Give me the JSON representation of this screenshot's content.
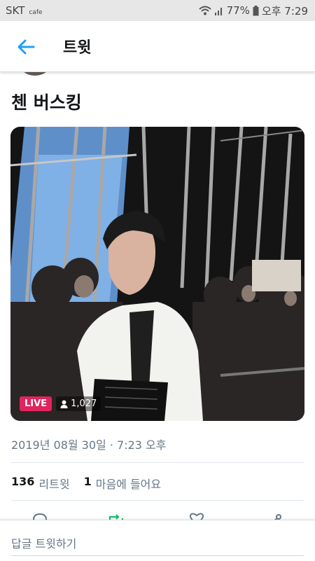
{
  "status_bar": {
    "carrier": "SKT",
    "carrier_sub": "cafe",
    "battery": "77%",
    "time": "오후 7:29"
  },
  "app_bar": {
    "title": "트윗"
  },
  "tweet": {
    "text": "첸 버스킹",
    "media": {
      "live_label": "LIVE",
      "viewers": "1,027"
    },
    "timestamp": "2019년 08월 30일 · 7:23 오후",
    "retweet_count": "136",
    "retweet_label": "리트윗",
    "like_count": "1",
    "like_label": "마음에 들어요"
  },
  "reply": {
    "placeholder": "답글 트윗하기"
  },
  "colors": {
    "accent": "#1da1f2",
    "retweet_green": "#17bf63",
    "live_red": "#e0245e",
    "muted": "#657786"
  }
}
